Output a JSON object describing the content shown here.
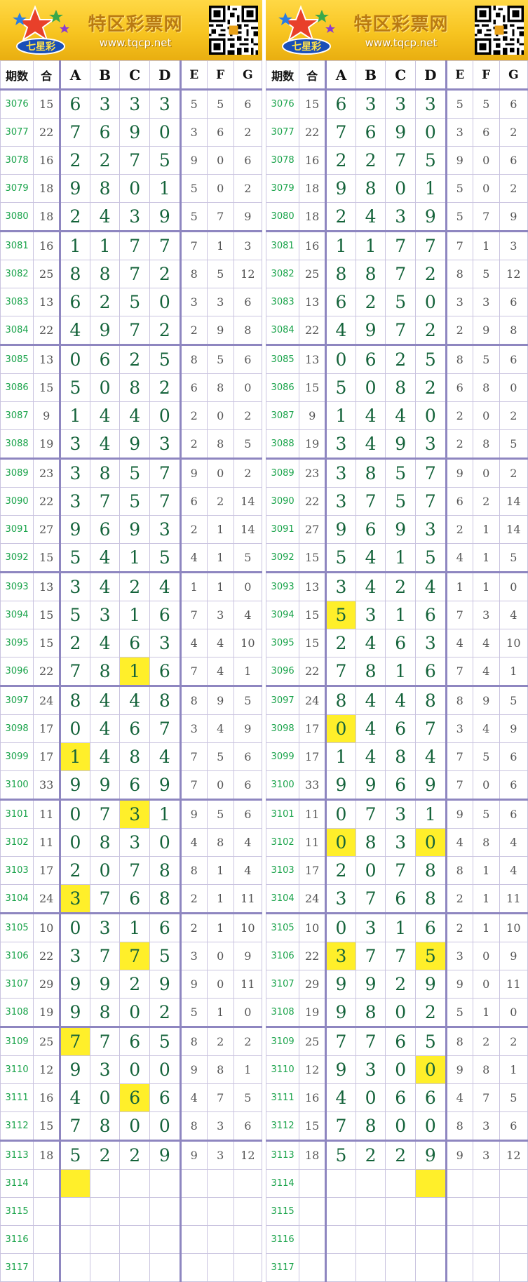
{
  "site": {
    "name": "特区彩票网",
    "url": "www.tqcp.net",
    "logo_text": "七星彩"
  },
  "headers": [
    "期数",
    "合",
    "A",
    "B",
    "C",
    "D",
    "E",
    "F",
    "G"
  ],
  "colors": {
    "highlight": "#ffef2a",
    "period_text": "#19a34a",
    "main_digit": "#14633a",
    "group_line": "#8e86c0",
    "header_bg": "#f7c420"
  },
  "rows": [
    {
      "period": "3076",
      "sum": "15",
      "a": "6",
      "b": "3",
      "c": "3",
      "d": "3",
      "e": "5",
      "f": "5",
      "g": "6"
    },
    {
      "period": "3077",
      "sum": "22",
      "a": "7",
      "b": "6",
      "c": "9",
      "d": "0",
      "e": "3",
      "f": "6",
      "g": "2"
    },
    {
      "period": "3078",
      "sum": "16",
      "a": "2",
      "b": "2",
      "c": "7",
      "d": "5",
      "e": "9",
      "f": "0",
      "g": "6"
    },
    {
      "period": "3079",
      "sum": "18",
      "a": "9",
      "b": "8",
      "c": "0",
      "d": "1",
      "e": "5",
      "f": "0",
      "g": "2"
    },
    {
      "period": "3080",
      "sum": "18",
      "a": "2",
      "b": "4",
      "c": "3",
      "d": "9",
      "e": "5",
      "f": "7",
      "g": "9"
    },
    {
      "period": "3081",
      "sum": "16",
      "a": "1",
      "b": "1",
      "c": "7",
      "d": "7",
      "e": "7",
      "f": "1",
      "g": "3"
    },
    {
      "period": "3082",
      "sum": "25",
      "a": "8",
      "b": "8",
      "c": "7",
      "d": "2",
      "e": "8",
      "f": "5",
      "g": "12"
    },
    {
      "period": "3083",
      "sum": "13",
      "a": "6",
      "b": "2",
      "c": "5",
      "d": "0",
      "e": "3",
      "f": "3",
      "g": "6"
    },
    {
      "period": "3084",
      "sum": "22",
      "a": "4",
      "b": "9",
      "c": "7",
      "d": "2",
      "e": "2",
      "f": "9",
      "g": "8"
    },
    {
      "period": "3085",
      "sum": "13",
      "a": "0",
      "b": "6",
      "c": "2",
      "d": "5",
      "e": "8",
      "f": "5",
      "g": "6"
    },
    {
      "period": "3086",
      "sum": "15",
      "a": "5",
      "b": "0",
      "c": "8",
      "d": "2",
      "e": "6",
      "f": "8",
      "g": "0"
    },
    {
      "period": "3087",
      "sum": "9",
      "a": "1",
      "b": "4",
      "c": "4",
      "d": "0",
      "e": "2",
      "f": "0",
      "g": "2"
    },
    {
      "period": "3088",
      "sum": "19",
      "a": "3",
      "b": "4",
      "c": "9",
      "d": "3",
      "e": "2",
      "f": "8",
      "g": "5"
    },
    {
      "period": "3089",
      "sum": "23",
      "a": "3",
      "b": "8",
      "c": "5",
      "d": "7",
      "e": "9",
      "f": "0",
      "g": "2"
    },
    {
      "period": "3090",
      "sum": "22",
      "a": "3",
      "b": "7",
      "c": "5",
      "d": "7",
      "e": "6",
      "f": "2",
      "g": "14"
    },
    {
      "period": "3091",
      "sum": "27",
      "a": "9",
      "b": "6",
      "c": "9",
      "d": "3",
      "e": "2",
      "f": "1",
      "g": "14"
    },
    {
      "period": "3092",
      "sum": "15",
      "a": "5",
      "b": "4",
      "c": "1",
      "d": "5",
      "e": "4",
      "f": "1",
      "g": "5"
    },
    {
      "period": "3093",
      "sum": "13",
      "a": "3",
      "b": "4",
      "c": "2",
      "d": "4",
      "e": "1",
      "f": "1",
      "g": "0"
    },
    {
      "period": "3094",
      "sum": "15",
      "a": "5",
      "b": "3",
      "c": "1",
      "d": "6",
      "e": "7",
      "f": "3",
      "g": "4"
    },
    {
      "period": "3095",
      "sum": "15",
      "a": "2",
      "b": "4",
      "c": "6",
      "d": "3",
      "e": "4",
      "f": "4",
      "g": "10"
    },
    {
      "period": "3096",
      "sum": "22",
      "a": "7",
      "b": "8",
      "c": "1",
      "d": "6",
      "e": "7",
      "f": "4",
      "g": "1"
    },
    {
      "period": "3097",
      "sum": "24",
      "a": "8",
      "b": "4",
      "c": "4",
      "d": "8",
      "e": "8",
      "f": "9",
      "g": "5"
    },
    {
      "period": "3098",
      "sum": "17",
      "a": "0",
      "b": "4",
      "c": "6",
      "d": "7",
      "e": "3",
      "f": "4",
      "g": "9"
    },
    {
      "period": "3099",
      "sum": "17",
      "a": "1",
      "b": "4",
      "c": "8",
      "d": "4",
      "e": "7",
      "f": "5",
      "g": "6"
    },
    {
      "period": "3100",
      "sum": "33",
      "a": "9",
      "b": "9",
      "c": "6",
      "d": "9",
      "e": "7",
      "f": "0",
      "g": "6"
    },
    {
      "period": "3101",
      "sum": "11",
      "a": "0",
      "b": "7",
      "c": "3",
      "d": "1",
      "e": "9",
      "f": "5",
      "g": "6"
    },
    {
      "period": "3102",
      "sum": "11",
      "a": "0",
      "b": "8",
      "c": "3",
      "d": "0",
      "e": "4",
      "f": "8",
      "g": "4"
    },
    {
      "period": "3103",
      "sum": "17",
      "a": "2",
      "b": "0",
      "c": "7",
      "d": "8",
      "e": "8",
      "f": "1",
      "g": "4"
    },
    {
      "period": "3104",
      "sum": "24",
      "a": "3",
      "b": "7",
      "c": "6",
      "d": "8",
      "e": "2",
      "f": "1",
      "g": "11"
    },
    {
      "period": "3105",
      "sum": "10",
      "a": "0",
      "b": "3",
      "c": "1",
      "d": "6",
      "e": "2",
      "f": "1",
      "g": "10"
    },
    {
      "period": "3106",
      "sum": "22",
      "a": "3",
      "b": "7",
      "c": "7",
      "d": "5",
      "e": "3",
      "f": "0",
      "g": "9"
    },
    {
      "period": "3107",
      "sum": "29",
      "a": "9",
      "b": "9",
      "c": "2",
      "d": "9",
      "e": "9",
      "f": "0",
      "g": "11"
    },
    {
      "period": "3108",
      "sum": "19",
      "a": "9",
      "b": "8",
      "c": "0",
      "d": "2",
      "e": "5",
      "f": "1",
      "g": "0"
    },
    {
      "period": "3109",
      "sum": "25",
      "a": "7",
      "b": "7",
      "c": "6",
      "d": "5",
      "e": "8",
      "f": "2",
      "g": "2"
    },
    {
      "period": "3110",
      "sum": "12",
      "a": "9",
      "b": "3",
      "c": "0",
      "d": "0",
      "e": "9",
      "f": "8",
      "g": "1"
    },
    {
      "period": "3111",
      "sum": "16",
      "a": "4",
      "b": "0",
      "c": "6",
      "d": "6",
      "e": "4",
      "f": "7",
      "g": "5"
    },
    {
      "period": "3112",
      "sum": "15",
      "a": "7",
      "b": "8",
      "c": "0",
      "d": "0",
      "e": "8",
      "f": "3",
      "g": "6"
    },
    {
      "period": "3113",
      "sum": "18",
      "a": "5",
      "b": "2",
      "c": "2",
      "d": "9",
      "e": "9",
      "f": "3",
      "g": "12"
    },
    {
      "period": "3114",
      "sum": "",
      "a": "",
      "b": "",
      "c": "",
      "d": "",
      "e": "",
      "f": "",
      "g": ""
    },
    {
      "period": "3115",
      "sum": "",
      "a": "",
      "b": "",
      "c": "",
      "d": "",
      "e": "",
      "f": "",
      "g": ""
    },
    {
      "period": "3116",
      "sum": "",
      "a": "",
      "b": "",
      "c": "",
      "d": "",
      "e": "",
      "f": "",
      "g": ""
    },
    {
      "period": "3117",
      "sum": "",
      "a": "",
      "b": "",
      "c": "",
      "d": "",
      "e": "",
      "f": "",
      "g": ""
    }
  ],
  "highlights": {
    "left": [
      [
        20,
        "c"
      ],
      [
        23,
        "a"
      ],
      [
        25,
        "c"
      ],
      [
        28,
        "a"
      ],
      [
        30,
        "c"
      ],
      [
        33,
        "a"
      ],
      [
        35,
        "c"
      ],
      [
        38,
        "a"
      ]
    ],
    "right": [
      [
        18,
        "a"
      ],
      [
        22,
        "a"
      ],
      [
        26,
        "a"
      ],
      [
        26,
        "d"
      ],
      [
        30,
        "a"
      ],
      [
        30,
        "d"
      ],
      [
        34,
        "d"
      ],
      [
        38,
        "d"
      ]
    ]
  },
  "group_starts": [
    5,
    9,
    13,
    17,
    21,
    25,
    29,
    33,
    37
  ]
}
